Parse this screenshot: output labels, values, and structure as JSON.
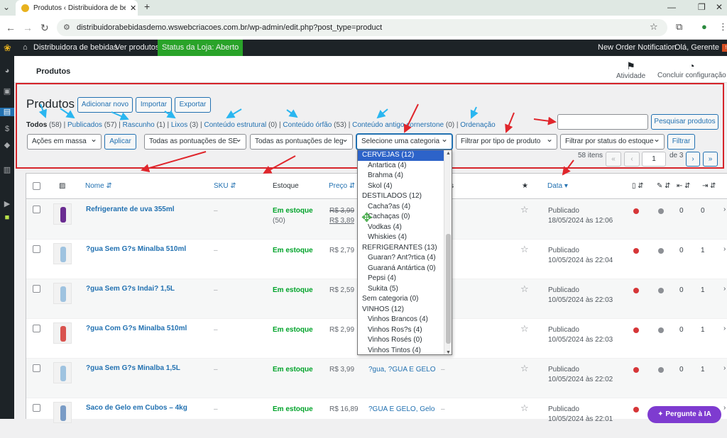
{
  "browser": {
    "tab_title": "Produtos ‹ Distribuidora de bebi",
    "url": "distribuidorabebidasdemo.wswebcriacoes.com.br/wp-admin/edit.php?post_type=product"
  },
  "adminbar": {
    "site": "Distribuidora de bebidas",
    "view": "Ver produtos",
    "store_status": "Status da Loja: Aberto",
    "notification": "New Order Notification",
    "greeting": "Olá, Gerente"
  },
  "subheader": {
    "title": "Produtos",
    "activity": "Atividade",
    "setup": "Concluir configuração"
  },
  "page": {
    "title": "Produtos",
    "buttons": {
      "add": "Adicionar novo",
      "import": "Importar",
      "export": "Exportar"
    },
    "subsubsub": [
      {
        "label": "Todos",
        "count": "(58)"
      },
      {
        "label": "Publicados",
        "count": "(57)"
      },
      {
        "label": "Rascunho",
        "count": "(1)"
      },
      {
        "label": "Lixos",
        "count": "(3)"
      },
      {
        "label": "Conteúdo estrutural",
        "count": "(0)"
      },
      {
        "label": "Conteúdo órfão",
        "count": "(53)"
      },
      {
        "label": "Conteúdo antigo cornerstone",
        "count": "(0)"
      },
      {
        "label": "Ordenação",
        "count": ""
      }
    ],
    "search_button": "Pesquisar produtos",
    "filters": {
      "bulk": "Ações em massa",
      "apply": "Aplicar",
      "seo_score": "Todas as pontuações de SE",
      "readability": "Todas as pontuações de leg",
      "category": "Selecione uma categoria",
      "product_type": "Filtrar por tipo de produto",
      "stock_status": "Filtrar por status do estoque",
      "filter": "Filtrar"
    },
    "pagination": {
      "items": "58 itens",
      "current": "1",
      "of": "de 3",
      "first": "«",
      "prev": "‹",
      "next": "›",
      "last": "»"
    }
  },
  "table": {
    "headers": {
      "name": "Nome",
      "sku": "SKU",
      "stock": "Estoque",
      "price": "Preço",
      "categories": "s",
      "date": "Data"
    },
    "rows": [
      {
        "name": "Refrigerante de uva 355ml",
        "sku": "–",
        "stock": "Em estoque",
        "stock_qty": "(50)",
        "price_old": "R$ 3,99",
        "price": "R$ 3,89",
        "cats": "rigerante de uva",
        "tags": "",
        "date_status": "Publicado",
        "date": "18/05/2024 às 12:06",
        "c1": "0",
        "c2": "0",
        "thumb_color": "#6a2c91"
      },
      {
        "name": "?gua Sem G?s Minalba 510ml",
        "sku": "–",
        "stock": "Em estoque",
        "stock_qty": "",
        "price_old": "",
        "price": "R$ 2,79",
        "cats": "",
        "tags": "",
        "date_status": "Publicado",
        "date": "10/05/2024 às 22:04",
        "c1": "0",
        "c2": "1",
        "thumb_color": "#9fc3e0"
      },
      {
        "name": "?gua Sem G?s Indai? 1,5L",
        "sku": "–",
        "stock": "Em estoque",
        "stock_qty": "",
        "price_old": "",
        "price": "R$ 2,59",
        "cats": "",
        "tags": "",
        "date_status": "Publicado",
        "date": "10/05/2024 às 22:03",
        "c1": "0",
        "c2": "1",
        "thumb_color": "#9fc3e0"
      },
      {
        "name": "?gua Com G?s Minalba 510ml",
        "sku": "–",
        "stock": "Em estoque",
        "stock_qty": "",
        "price_old": "",
        "price": "R$ 2,99",
        "cats": "",
        "tags": "",
        "date_status": "Publicado",
        "date": "10/05/2024 às 22:03",
        "c1": "0",
        "c2": "1",
        "thumb_color": "#d9534f"
      },
      {
        "name": "?gua Sem G?s Minalba 1,5L",
        "sku": "–",
        "stock": "Em estoque",
        "stock_qty": "",
        "price_old": "",
        "price": "R$ 3,99",
        "cats": "?gua, ?GUA E GELO",
        "tags": "–",
        "date_status": "Publicado",
        "date": "10/05/2024 às 22:02",
        "c1": "0",
        "c2": "1",
        "thumb_color": "#9fc3e0"
      },
      {
        "name": "Saco de Gelo em Cubos – 4kg",
        "sku": "–",
        "stock": "Em estoque",
        "stock_qty": "",
        "price_old": "",
        "price": "R$ 16,89",
        "cats": "?GUA E GELO, Gelo",
        "tags": "–",
        "date_status": "Publicado",
        "date": "10/05/2024 às 22:01",
        "c1": "",
        "c2": "",
        "thumb_color": "#7a9cc6"
      }
    ]
  },
  "dropdown": [
    {
      "label": "CERVEJAS  (12)",
      "indent": false,
      "hl": true
    },
    {
      "label": "Antartica  (4)",
      "indent": true
    },
    {
      "label": "Brahma  (4)",
      "indent": true
    },
    {
      "label": "Skol  (4)",
      "indent": true
    },
    {
      "label": "DESTILADOS  (12)",
      "indent": false
    },
    {
      "label": "Cacha?as  (4)",
      "indent": true
    },
    {
      "label": "Cachaças  (0)",
      "indent": true
    },
    {
      "label": "Vodkas  (4)",
      "indent": true
    },
    {
      "label": "Whiskies  (4)",
      "indent": true
    },
    {
      "label": "REFRIGERANTES  (13)",
      "indent": false
    },
    {
      "label": "Guaran? Ant?rtica  (4)",
      "indent": true
    },
    {
      "label": "Guaraná Antártica  (0)",
      "indent": true
    },
    {
      "label": "Pepsi  (4)",
      "indent": true
    },
    {
      "label": "Sukita  (5)",
      "indent": true
    },
    {
      "label": "Sem categoria  (0)",
      "indent": false
    },
    {
      "label": "VINHOS  (12)",
      "indent": false
    },
    {
      "label": "Vinhos Brancos  (4)",
      "indent": true
    },
    {
      "label": "Vinhos Ros?s  (4)",
      "indent": true
    },
    {
      "label": "Vinhos Rosés  (0)",
      "indent": true
    },
    {
      "label": "Vinhos Tintos  (4)",
      "indent": true
    }
  ],
  "ai_button": "Pergunte à IA"
}
